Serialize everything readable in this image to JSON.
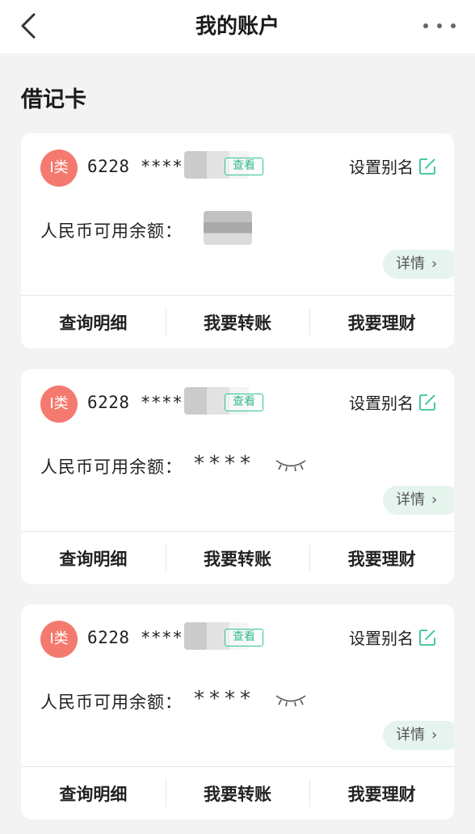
{
  "header": {
    "title": "我的账户",
    "back_icon": "chevron-left-icon",
    "more_icon": "more-horizontal-icon"
  },
  "section": {
    "title": "借记卡"
  },
  "cards": [
    {
      "badge": "I类",
      "account_prefix": "6228 ****",
      "view_label": "查看",
      "alias_label": "设置别名",
      "balance_label": "人民币可用余额：",
      "balance_value": "",
      "balance_hidden": false,
      "detail_label": "详情",
      "actions": [
        "查询明细",
        "我要转账",
        "我要理财"
      ]
    },
    {
      "badge": "I类",
      "account_prefix": "6228 ****",
      "view_label": "查看",
      "alias_label": "设置别名",
      "balance_label": "人民币可用余额：",
      "balance_value": "****",
      "balance_hidden": true,
      "detail_label": "详情",
      "actions": [
        "查询明细",
        "我要转账",
        "我要理财"
      ]
    },
    {
      "badge": "I类",
      "account_prefix": "6228 ****",
      "view_label": "查看",
      "alias_label": "设置别名",
      "balance_label": "人民币可用余额：",
      "balance_value": "****",
      "balance_hidden": true,
      "detail_label": "详情",
      "actions": [
        "查询明细",
        "我要转账",
        "我要理财"
      ]
    }
  ],
  "colors": {
    "accent": "#33c29a",
    "badge": "#f47a6f",
    "detail_bg": "#e5f4ed",
    "page_bg": "#f3f3f3"
  }
}
